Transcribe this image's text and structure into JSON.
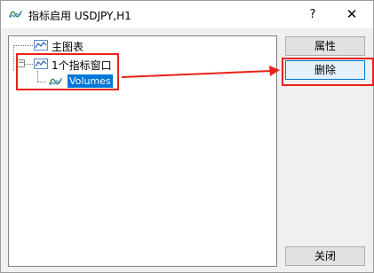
{
  "window": {
    "title": "指标启用 USDJPY,H1",
    "title_icon": "indicator-wave-icon",
    "help_label": "?",
    "close_label": "✕"
  },
  "tree": {
    "root": {
      "label": "主图表",
      "icon": "chart-line-icon"
    },
    "group": {
      "label": "1个指标窗口",
      "icon": "chart-line-icon",
      "expanded": true,
      "expander": "−"
    },
    "item": {
      "label": "Volumes",
      "icon": "indicator-wave-icon",
      "selected": true
    }
  },
  "buttons": {
    "properties": "属性",
    "delete": "删除",
    "close": "关闭"
  },
  "annotation_color": "#e8221a",
  "selection_color": "#0078d7"
}
